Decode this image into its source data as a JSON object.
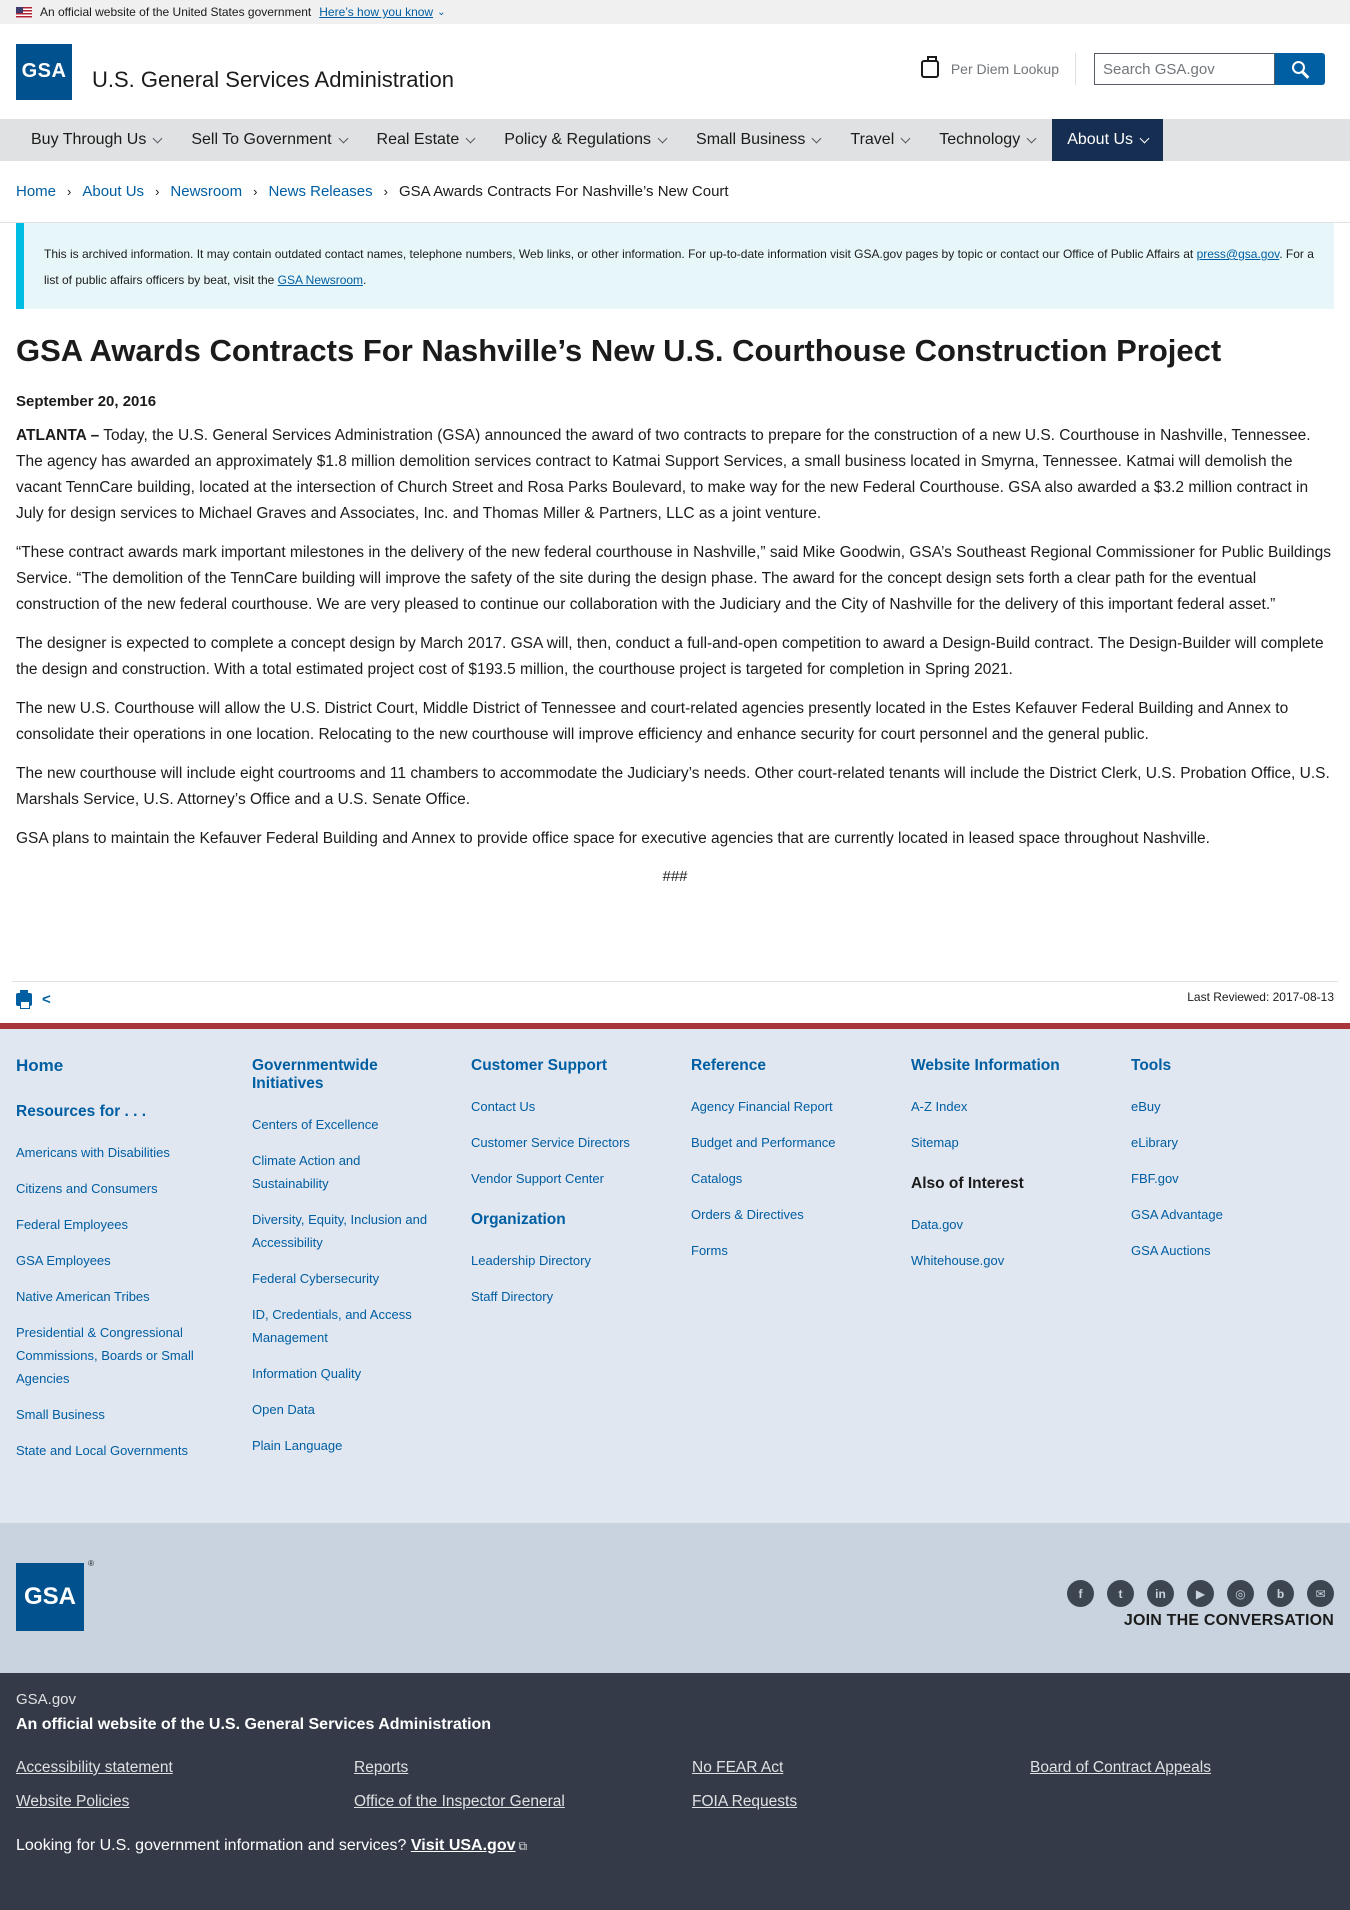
{
  "banner": {
    "text": "An official website of the United States government",
    "howto": "Here’s how you know"
  },
  "header": {
    "logo_text": "GSA",
    "site_name": "U.S. General Services Administration",
    "per_diem": "Per Diem Lookup",
    "search_placeholder": "Search GSA.gov"
  },
  "nav": {
    "items": [
      {
        "label": "Buy Through Us"
      },
      {
        "label": "Sell To Government"
      },
      {
        "label": "Real Estate"
      },
      {
        "label": "Policy & Regulations"
      },
      {
        "label": "Small Business"
      },
      {
        "label": "Travel"
      },
      {
        "label": "Technology"
      },
      {
        "label": "About Us"
      }
    ]
  },
  "breadcrumb": {
    "items": [
      "Home",
      "About Us",
      "Newsroom",
      "News Releases"
    ],
    "current": "GSA Awards Contracts For Nashville’s New Court"
  },
  "alert": {
    "text1": "This is archived information. It may contain outdated contact names, telephone numbers, Web links, or other information. For up-to-date information visit GSA.gov pages by topic or contact our Office of Public Affairs at ",
    "email": "press@gsa.gov",
    "text2": ". For a list of public affairs officers by beat, visit the ",
    "newsroom": "GSA Newsroom",
    "text3": "."
  },
  "article": {
    "title": "GSA Awards Contracts For Nashville’s New U.S. Courthouse Construction Project",
    "date": "September 20, 2016",
    "dateline": "ATLANTA –",
    "p1": " Today, the U.S. General Services Administration (GSA) announced the award of two contracts to prepare for the construction of a new U.S. Courthouse in Nashville, Tennessee. The agency has awarded an approximately $1.8 million demolition services contract to Katmai Support Services, a small business located in Smyrna, Tennessee. Katmai will demolish the vacant TennCare building, located at the intersection of Church Street and Rosa Parks Boulevard, to make way for the new Federal Courthouse. GSA also awarded a $3.2 million contract in July for design services to Michael Graves and Associates, Inc. and Thomas Miller & Partners, LLC as a joint venture.",
    "p2": "“These contract awards mark important milestones in the delivery of the new federal courthouse in Nashville,” said Mike Goodwin, GSA’s Southeast Regional Commissioner for Public Buildings Service. “The demolition of the TennCare building will improve the safety of the site during the design phase. The award for the concept design sets forth a clear path for the eventual construction of the new federal courthouse. We are very pleased to continue our collaboration with the Judiciary and the City of Nashville for the delivery of this important federal asset.”",
    "p3": "The designer is expected to complete a concept design by March 2017. GSA will, then, conduct a full-and-open competition to award a Design-Build contract. The Design-Builder will complete the design and construction. With a total estimated project cost of $193.5 million, the courthouse project is targeted for completion in Spring 2021.",
    "p4": "The new U.S. Courthouse will allow the U.S. District Court, Middle District of Tennessee and court-related agencies presently located in the Estes Kefauver Federal Building and Annex to consolidate their operations in one location. Relocating to the new courthouse will improve efficiency and enhance security for court personnel and the general public.",
    "p5": "The new courthouse will include eight courtrooms and 11 chambers to accommodate the Judiciary’s needs. Other court-related tenants will include the District Clerk, U.S. Probation Office, U.S. Marshals Service, U.S. Attorney’s Office and a U.S. Senate Office.",
    "p6": "GSA plans to maintain the Kefauver Federal Building and Annex to provide office space for executive agencies that are currently located in leased space throughout Nashville.",
    "hashes": "###",
    "last_reviewed": "Last Reviewed: 2017-08-13"
  },
  "footer": {
    "col1": {
      "home": "Home",
      "resources": "Resources for . . .",
      "links": [
        "Americans with Disabilities",
        "Citizens and Consumers",
        "Federal Employees",
        "GSA Employees",
        "Native American Tribes",
        "Presidential & Congressional Commissions, Boards or Small Agencies",
        "Small Business",
        "State and Local Governments"
      ]
    },
    "col2": {
      "heading": "Governmentwide Initiatives",
      "links": [
        "Centers of Excellence",
        "Climate Action and Sustainability",
        "Diversity, Equity, Inclusion and Accessibility",
        "Federal Cybersecurity",
        "ID, Credentials, and Access Management",
        "Information Quality",
        "Open Data",
        "Plain Language"
      ]
    },
    "col3": {
      "heading": "Customer Support",
      "links": [
        "Contact Us",
        "Customer Service Directors",
        "Vendor Support Center"
      ],
      "heading2": "Organization",
      "links2": [
        "Leadership Directory",
        "Staff Directory"
      ]
    },
    "col4": {
      "heading": "Reference",
      "links": [
        "Agency Financial Report",
        "Budget and Performance",
        "Catalogs",
        "Orders & Directives",
        "Forms"
      ]
    },
    "col5": {
      "heading": "Website Information",
      "links": [
        "A-Z Index",
        "Sitemap"
      ],
      "heading2": "Also of Interest",
      "links2": [
        "Data.gov",
        "Whitehouse.gov"
      ]
    },
    "col6": {
      "heading": "Tools",
      "links": [
        "eBuy",
        "eLibrary",
        "FBF.gov",
        "GSA Advantage",
        "GSA Auctions"
      ]
    },
    "logo_text": "GSA",
    "reg": "®",
    "social_icons": [
      "facebook-icon",
      "twitter-icon",
      "linkedin-icon",
      "youtube-icon",
      "instagram-icon",
      "blog-icon",
      "email-icon"
    ],
    "join": "JOIN THE CONVERSATION",
    "gsagov": "GSA.gov",
    "official": "An official website of the U.S. General Services Administration",
    "bottom_links": [
      "Accessibility statement",
      "Reports",
      "No FEAR Act",
      "Board of Contract Appeals",
      "Website Policies",
      "Office of the Inspector General",
      "FOIA Requests"
    ],
    "looking": "Looking for U.S. government information and services? ",
    "visit": "Visit USA.gov"
  },
  "colors": {
    "primary": "#005ea2",
    "nav_active": "#162e51",
    "alert_bg": "#e7f6f8",
    "alert_border": "#00bde3",
    "footer_accent": "#a8353a",
    "footer_bottom": "#343a47"
  }
}
